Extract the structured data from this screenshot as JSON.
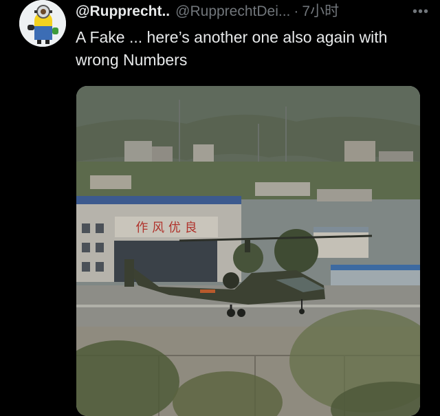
{
  "tweet": {
    "avatar_icon": "minion-avatar-icon",
    "display_name": "@Rupprecht..",
    "handle": "@RupprechtDei...",
    "separator": "·",
    "time": "7小时",
    "more_icon": "more-options-icon",
    "more_glyph": "•••",
    "text": "A Fake ... here’s another one also again with wrong Numbers"
  },
  "media": {
    "kind": "photo",
    "building_sign": "作 风 优 良",
    "accent_color": "#1d9bf0"
  }
}
